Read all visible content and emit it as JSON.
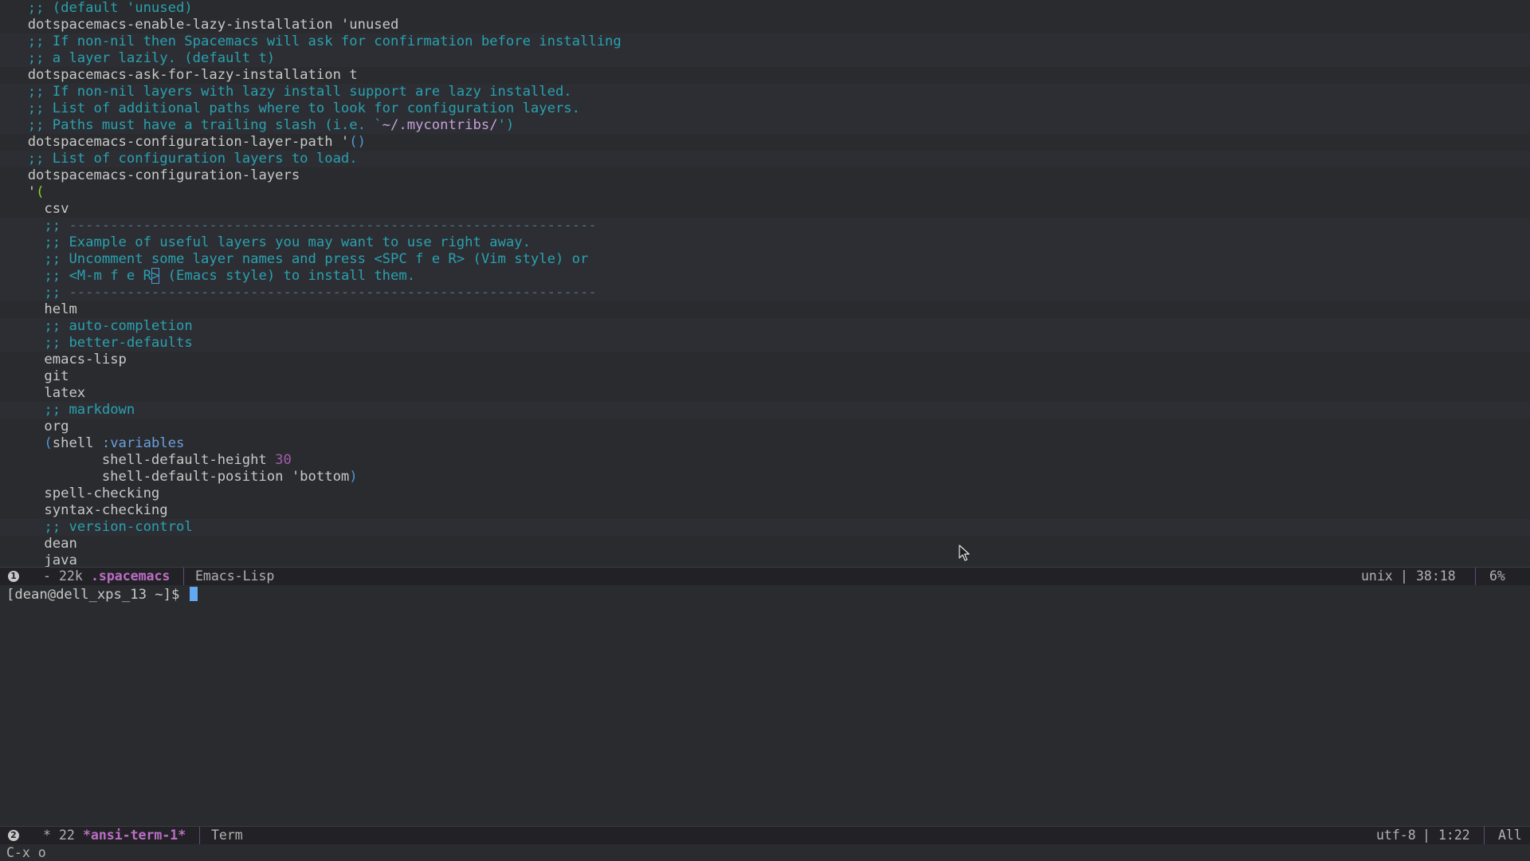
{
  "editor": {
    "lines": [
      {
        "indent": "  ",
        "parts": [
          {
            "t": ";; (default 'unused)",
            "c": "c-comment"
          }
        ]
      },
      {
        "indent": "  ",
        "parts": [
          {
            "t": "dotspacemacs-enable-lazy-installation 'unused",
            "c": "c-text"
          }
        ]
      },
      {
        "indent": "  ",
        "parts": [
          {
            "t": ";; If non-nil then Spacemacs will ask for confirmation before installing",
            "c": "c-comment"
          }
        ],
        "hl": true
      },
      {
        "indent": "  ",
        "parts": [
          {
            "t": ";; a layer lazily. (default t)",
            "c": "c-comment"
          }
        ],
        "hl": true
      },
      {
        "indent": "  ",
        "parts": [
          {
            "t": "dotspacemacs-ask-for-lazy-installation t",
            "c": "c-text"
          }
        ]
      },
      {
        "indent": "  ",
        "parts": [
          {
            "t": ";; If non-nil layers with lazy install support are lazy installed.",
            "c": "c-comment"
          }
        ],
        "hl": true
      },
      {
        "indent": "  ",
        "parts": [
          {
            "t": ";; List of additional paths where to look for configuration layers.",
            "c": "c-comment"
          }
        ],
        "hl": true
      },
      {
        "indent": "  ",
        "parts": [
          {
            "t": ";; Paths must have a trailing slash (i.e. `",
            "c": "c-comment"
          },
          {
            "t": "~/.mycontribs/",
            "c": "c-str"
          },
          {
            "t": "')",
            "c": "c-comment"
          }
        ],
        "hl": true
      },
      {
        "indent": "  ",
        "parts": [
          {
            "t": "dotspacemacs-configuration-layer-path '",
            "c": "c-text"
          },
          {
            "t": "()",
            "c": "c-paren1"
          }
        ]
      },
      {
        "indent": "  ",
        "parts": [
          {
            "t": ";; List of configuration layers to load.",
            "c": "c-comment"
          }
        ],
        "hl": true
      },
      {
        "indent": "  ",
        "parts": [
          {
            "t": "dotspacemacs-configuration-layers",
            "c": "c-text"
          }
        ]
      },
      {
        "indent": "  ",
        "parts": [
          {
            "t": "'",
            "c": "c-text"
          },
          {
            "t": "(",
            "c": "c-paren2"
          }
        ]
      },
      {
        "indent": "    ",
        "parts": [
          {
            "t": "csv",
            "c": "c-text"
          }
        ]
      },
      {
        "indent": "    ",
        "parts": [
          {
            "t": ";; ",
            "c": "c-comment"
          },
          {
            "t": "----------------------------------------------------------------",
            "c": "c-dim"
          }
        ],
        "hl": true
      },
      {
        "indent": "    ",
        "parts": [
          {
            "t": ";; Example of useful layers you may want to use right away.",
            "c": "c-comment"
          }
        ],
        "hl": true
      },
      {
        "indent": "    ",
        "parts": [
          {
            "t": ";; Uncomment some layer names and press <SPC f e R> (Vim style) or",
            "c": "c-comment"
          }
        ],
        "hl": true
      },
      {
        "indent": "    ",
        "parts": [
          {
            "t": ";; <M-m f e R",
            "c": "c-comment"
          },
          {
            "t": ">",
            "c": "c-comment cursor-box"
          },
          {
            "t": " (Emacs style) to install them.",
            "c": "c-comment"
          }
        ],
        "hl": true
      },
      {
        "indent": "    ",
        "parts": [
          {
            "t": ";; ",
            "c": "c-comment"
          },
          {
            "t": "----------------------------------------------------------------",
            "c": "c-dim"
          }
        ],
        "hl": true
      },
      {
        "indent": "    ",
        "parts": [
          {
            "t": "helm",
            "c": "c-text"
          }
        ]
      },
      {
        "indent": "    ",
        "parts": [
          {
            "t": ";; auto-completion",
            "c": "c-comment"
          }
        ],
        "hl": true
      },
      {
        "indent": "    ",
        "parts": [
          {
            "t": ";; better-defaults",
            "c": "c-comment"
          }
        ],
        "hl": true
      },
      {
        "indent": "    ",
        "parts": [
          {
            "t": "emacs-lisp",
            "c": "c-text"
          }
        ]
      },
      {
        "indent": "    ",
        "parts": [
          {
            "t": "git",
            "c": "c-text"
          }
        ]
      },
      {
        "indent": "    ",
        "parts": [
          {
            "t": "latex",
            "c": "c-text"
          }
        ]
      },
      {
        "indent": "    ",
        "parts": [
          {
            "t": ";; markdown",
            "c": "c-comment"
          }
        ],
        "hl": true
      },
      {
        "indent": "    ",
        "parts": [
          {
            "t": "org",
            "c": "c-text"
          }
        ]
      },
      {
        "indent": "    ",
        "parts": [
          {
            "t": "(",
            "c": "c-paren1"
          },
          {
            "t": "shell ",
            "c": "c-text"
          },
          {
            "t": ":variables",
            "c": "c-kw"
          }
        ]
      },
      {
        "indent": "           ",
        "parts": [
          {
            "t": "shell-default-height ",
            "c": "c-text"
          },
          {
            "t": "30",
            "c": "c-num"
          }
        ]
      },
      {
        "indent": "           ",
        "parts": [
          {
            "t": "shell-default-position 'bottom",
            "c": "c-text"
          },
          {
            "t": ")",
            "c": "c-paren1"
          }
        ]
      },
      {
        "indent": "    ",
        "parts": [
          {
            "t": "spell-checking",
            "c": "c-text"
          }
        ]
      },
      {
        "indent": "    ",
        "parts": [
          {
            "t": "syntax-checking",
            "c": "c-text"
          }
        ]
      },
      {
        "indent": "    ",
        "parts": [
          {
            "t": ";; version-control",
            "c": "c-comment"
          }
        ],
        "hl": true
      },
      {
        "indent": "    ",
        "parts": [
          {
            "t": "dean",
            "c": "c-text"
          }
        ]
      },
      {
        "indent": "    ",
        "parts": [
          {
            "t": "java",
            "c": "c-text"
          }
        ]
      }
    ]
  },
  "modeline_top": {
    "window_number": "1",
    "modified": "-",
    "size": "22k",
    "buffer_name": ".spacemacs",
    "major_mode": "Emacs-Lisp",
    "encoding": "unix",
    "position": "38:18",
    "percent": "6%"
  },
  "terminal": {
    "prompt": "[dean@dell_xps_13 ~]$ "
  },
  "modeline_bottom": {
    "window_number": "2",
    "modified": "*",
    "size": "22",
    "buffer_name": "*ansi-term-1*",
    "major_mode": "Term",
    "encoding": "utf-8",
    "position": "1:22",
    "percent": "All"
  },
  "minibuffer": {
    "text": "C-x o"
  },
  "colors": {
    "background": "#292b2e",
    "comment": "#2aa1ae",
    "buffer_name": "#bc6ec5",
    "modeline_bg": "#222226"
  }
}
